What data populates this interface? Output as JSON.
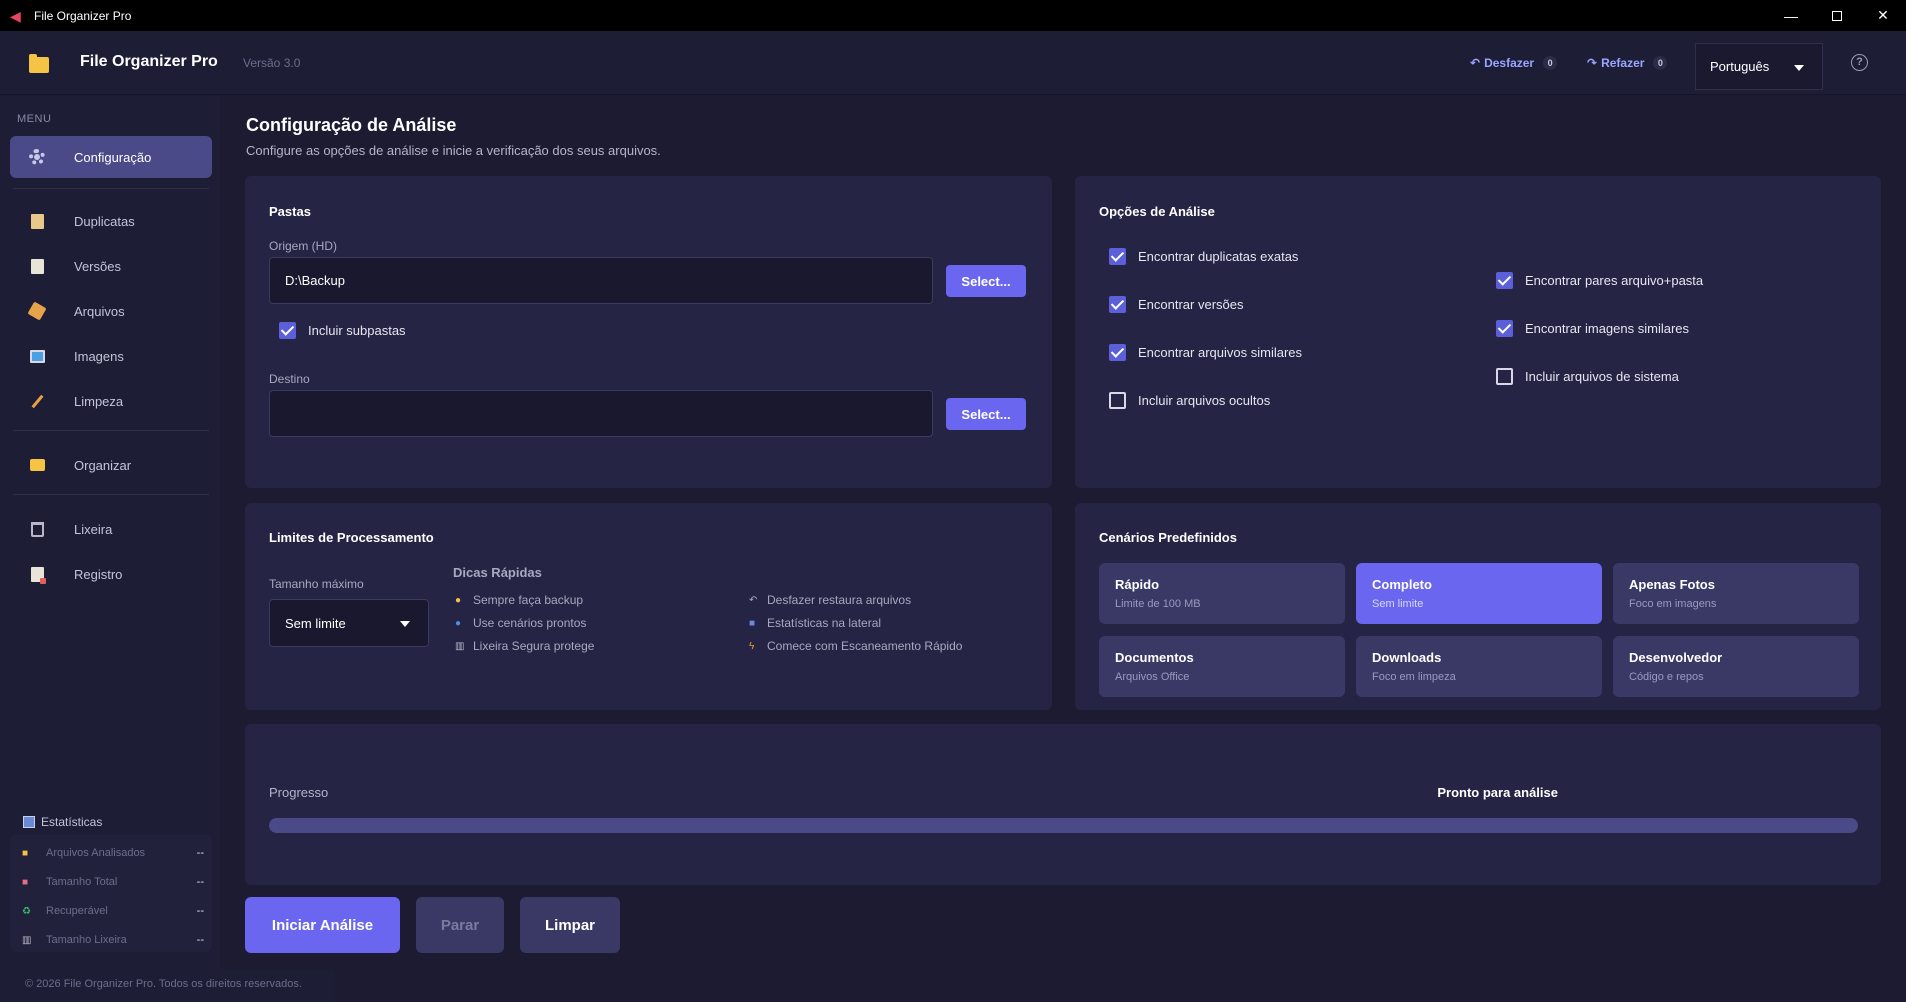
{
  "window": {
    "title": "File Organizer Pro"
  },
  "header": {
    "app_name": "File Organizer Pro",
    "version": "Versão 3.0",
    "undo_label": "Desfazer",
    "undo_count": "0",
    "redo_label": "Refazer",
    "redo_count": "0",
    "language": "Português"
  },
  "sidebar": {
    "menu_label": "MENU",
    "items": [
      {
        "label": "Configuração",
        "icon": "gear-icon",
        "active": true
      },
      {
        "label": "Duplicatas",
        "icon": "clipboard-icon"
      },
      {
        "label": "Versões",
        "icon": "document-icon"
      },
      {
        "label": "Arquivos",
        "icon": "package-icon"
      },
      {
        "label": "Imagens",
        "icon": "picture-icon"
      },
      {
        "label": "Limpeza",
        "icon": "broom-icon"
      },
      {
        "label": "Organizar",
        "icon": "folder-icon"
      },
      {
        "label": "Lixeira",
        "icon": "trash-icon"
      },
      {
        "label": "Registro",
        "icon": "log-icon"
      }
    ],
    "stats_title": "Estatísticas",
    "stats": [
      {
        "label": "Arquivos Analisados",
        "value": "--",
        "icon": "folder-icon"
      },
      {
        "label": "Tamanho Total",
        "value": "--",
        "icon": "disk-icon"
      },
      {
        "label": "Recuperável",
        "value": "--",
        "icon": "recycle-icon"
      },
      {
        "label": "Tamanho Lixeira",
        "value": "--",
        "icon": "trash-icon"
      }
    ]
  },
  "footer": {
    "text": "© 2026 File Organizer Pro. Todos os direitos reservados."
  },
  "main": {
    "title": "Configuração de Análise",
    "subtitle": "Configure as opções de análise e inicie a verificação dos seus arquivos.",
    "folders": {
      "title": "Pastas",
      "source_label": "Origem (HD)",
      "source_value": "D:\\Backup",
      "select_label": "Select...",
      "include_subfolders": "Incluir subpastas",
      "dest_label": "Destino",
      "dest_value": ""
    },
    "options": {
      "title": "Opções de Análise",
      "left": [
        {
          "label": "Encontrar duplicatas exatas",
          "checked": true
        },
        {
          "label": "Encontrar versões",
          "checked": true
        },
        {
          "label": "Encontrar arquivos similares",
          "checked": true
        },
        {
          "label": "Incluir arquivos ocultos",
          "checked": false
        }
      ],
      "right": [
        {
          "label": "Encontrar pares arquivo+pasta",
          "checked": true
        },
        {
          "label": "Encontrar imagens similares",
          "checked": true
        },
        {
          "label": "Incluir arquivos de sistema",
          "checked": false
        }
      ]
    },
    "limits": {
      "title": "Limites de Processamento",
      "max_size_label": "Tamanho máximo",
      "max_size_value": "Sem limite",
      "tips_title": "Dicas Rápidas",
      "tips": [
        "Sempre faça backup",
        "Use cenários prontos",
        "Lixeira Segura protege",
        "Desfazer restaura arquivos",
        "Estatísticas na lateral",
        "Comece com Escaneamento Rápido"
      ]
    },
    "presets": {
      "title": "Cenários Predefinidos",
      "items": [
        {
          "name": "Rápido",
          "desc": "Limite de 100 MB"
        },
        {
          "name": "Completo",
          "desc": "Sem limite",
          "active": true
        },
        {
          "name": "Apenas Fotos",
          "desc": "Foco em imagens"
        },
        {
          "name": "Documentos",
          "desc": "Arquivos Office"
        },
        {
          "name": "Downloads",
          "desc": "Foco em limpeza"
        },
        {
          "name": "Desenvolvedor",
          "desc": "Código e repos"
        }
      ]
    },
    "progress": {
      "label": "Progresso",
      "status": "Pronto para análise",
      "percent": 0
    },
    "actions": {
      "start": "Iniciar Análise",
      "stop": "Parar",
      "clear": "Limpar"
    }
  },
  "colors": {
    "accent": "#6b66f0",
    "background": "#1c1b32",
    "card": "#252444"
  }
}
